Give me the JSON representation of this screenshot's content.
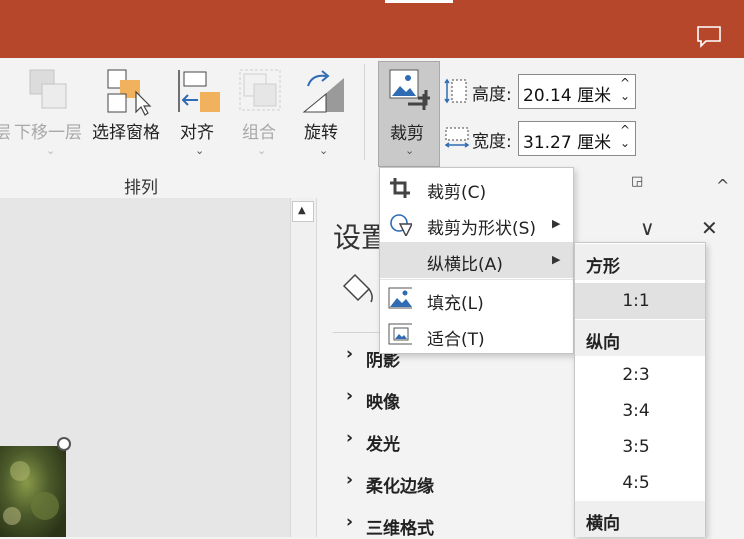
{
  "colors": {
    "titlebar": "#b7472a",
    "accent_blue": "#2f6cb3",
    "accent_orange": "#f0b25c",
    "hover_gray": "#e1e1e1",
    "pressed_gray": "#c9c9c9"
  },
  "ribbon": {
    "partial_label": "层",
    "send_backward": {
      "label": "下移一层",
      "icon": "send-backward-icon"
    },
    "selection_pane": {
      "label": "选择窗格",
      "icon": "selection-pane-icon"
    },
    "align": {
      "label": "对齐",
      "icon": "align-icon"
    },
    "group": {
      "label": "组合",
      "icon": "group-icon"
    },
    "rotate": {
      "label": "旋转",
      "icon": "rotate-icon"
    },
    "group_label": "排列",
    "crop": {
      "label": "裁剪",
      "icon": "crop-picture-icon"
    },
    "height": {
      "label": "高度:",
      "value": "20.14 厘米"
    },
    "width": {
      "label": "宽度:",
      "value": "31.27 厘米"
    },
    "chevron": "⌄",
    "spin_up": "^",
    "spin_down": "⌄",
    "dialog_launcher": "◲",
    "collapse": "^"
  },
  "crop_menu": {
    "items": [
      {
        "label": "裁剪(C)",
        "icon": "crop-icon"
      },
      {
        "label": "裁剪为形状(S)",
        "icon": "crop-to-shape-icon",
        "arrow": "▶"
      },
      {
        "label": "纵横比(A)",
        "icon": "",
        "arrow": "▶"
      },
      {
        "label": "填充(L)",
        "icon": "fill-picture-icon"
      },
      {
        "label": "适合(T)",
        "icon": "fit-picture-icon"
      }
    ]
  },
  "aspect_submenu": {
    "square_header": "方形",
    "square_items": [
      "1:1"
    ],
    "portrait_header": "纵向",
    "portrait_items": [
      "2:3",
      "3:4",
      "3:5",
      "4:5"
    ],
    "landscape_header": "横向"
  },
  "pane": {
    "title_partial": "设置",
    "collapse_glyph": "∨",
    "close_glyph": "✕",
    "sections": [
      "阴影",
      "映像",
      "发光",
      "柔化边缘",
      "三维格式"
    ],
    "section_chevron": "›"
  },
  "scroll_up_glyph": "▲"
}
